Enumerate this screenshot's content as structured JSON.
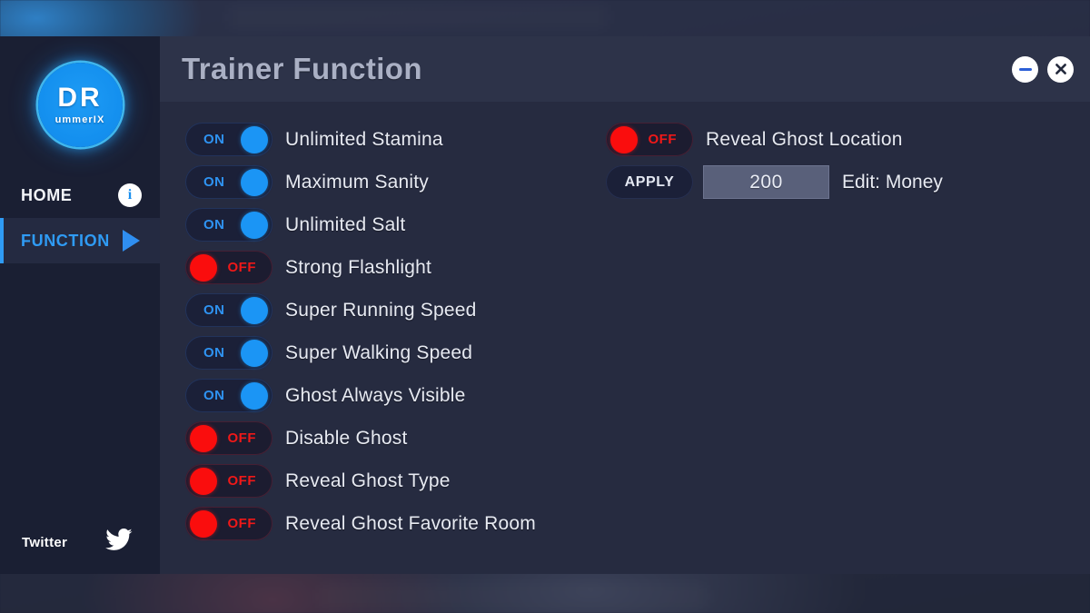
{
  "window": {
    "title": "Trainer Function",
    "minimize_icon": "minimize-icon",
    "close_icon": "close-icon",
    "close_glyph": "✕"
  },
  "sidebar": {
    "logo": {
      "main": "DR",
      "sub": "ummerIX"
    },
    "nav": [
      {
        "label": "HOME",
        "icon": "info-icon",
        "icon_glyph": "i",
        "active": false
      },
      {
        "label": "FUNCTION",
        "icon": "play-icon",
        "active": true
      }
    ],
    "footer": {
      "label": "Twitter",
      "icon": "twitter-icon"
    }
  },
  "toggles_left": [
    {
      "label": "Unlimited Stamina",
      "state": "ON"
    },
    {
      "label": "Maximum Sanity",
      "state": "ON"
    },
    {
      "label": "Unlimited Salt",
      "state": "ON"
    },
    {
      "label": "Strong Flashlight",
      "state": "OFF"
    },
    {
      "label": "Super Running Speed",
      "state": "ON"
    },
    {
      "label": "Super Walking Speed",
      "state": "ON"
    },
    {
      "label": "Ghost Always Visible",
      "state": "ON"
    },
    {
      "label": "Disable Ghost",
      "state": "OFF"
    },
    {
      "label": "Reveal Ghost Type",
      "state": "OFF"
    },
    {
      "label": "Reveal Ghost Favorite Room",
      "state": "OFF"
    }
  ],
  "toggles_right": [
    {
      "label": "Reveal Ghost Location",
      "state": "OFF"
    }
  ],
  "editor": {
    "apply_label": "APPLY",
    "value": "200",
    "placeholder": "200",
    "label": "Edit: Money"
  },
  "colors": {
    "accent_blue": "#2f9bf4",
    "toggle_on": "#1b95f5",
    "toggle_off": "#fa0d0d",
    "sidebar_bg": "#1a1f33",
    "main_bg": "#262b40",
    "titlebar_bg": "#2d3349",
    "title_text": "#aab0c4"
  }
}
